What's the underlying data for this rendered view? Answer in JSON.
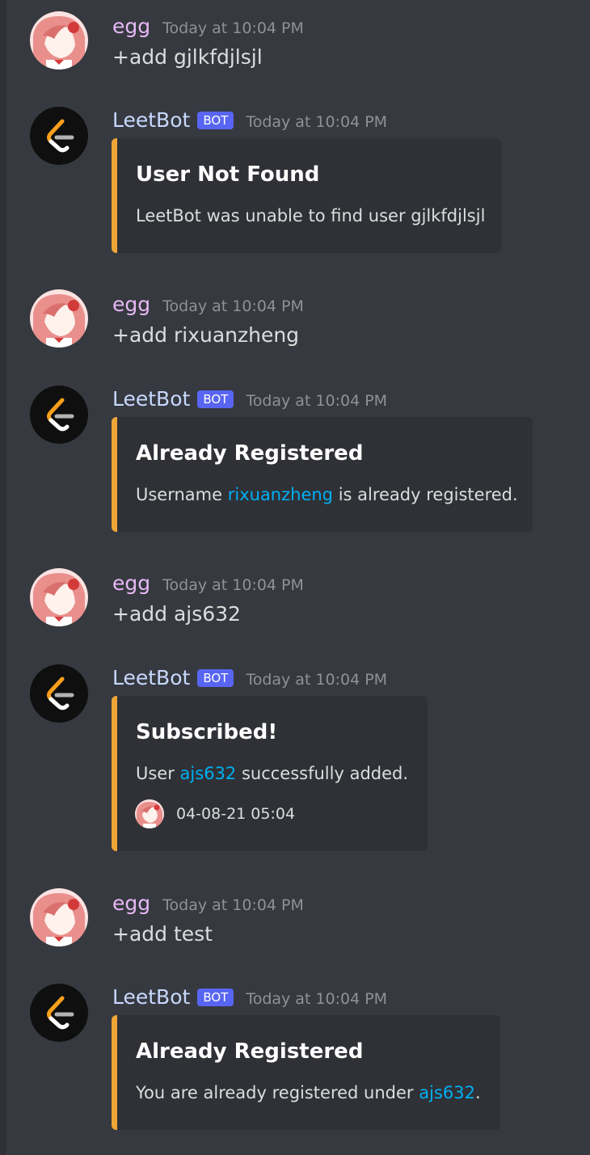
{
  "colors": {
    "background": "#36393f",
    "embed_background": "#2f3136",
    "embed_accent": "#f0a637",
    "link": "#00aff4",
    "bot_tag": "#5865f2"
  },
  "messages": [
    {
      "author": "egg",
      "timestamp": "Today at 10:04 PM",
      "avatar_icon": "anime-girl-avatar-icon",
      "text": "+add gjlkfdjlsjl"
    },
    {
      "author": "LeetBot",
      "bot_tag": "BOT",
      "timestamp": "Today at 10:04 PM",
      "avatar_icon": "leetcode-logo-icon",
      "embed": {
        "title": "User Not Found",
        "description": "LeetBot was unable to find user gjlkfdjlsjl"
      }
    },
    {
      "author": "egg",
      "timestamp": "Today at 10:04 PM",
      "avatar_icon": "anime-girl-avatar-icon",
      "text": "+add rixuanzheng"
    },
    {
      "author": "LeetBot",
      "bot_tag": "BOT",
      "timestamp": "Today at 10:04 PM",
      "avatar_icon": "leetcode-logo-icon",
      "embed": {
        "title": "Already Registered",
        "desc_before": "Username ",
        "desc_link": "rixuanzheng",
        "desc_after": " is already registered."
      }
    },
    {
      "author": "egg",
      "timestamp": "Today at 10:04 PM",
      "avatar_icon": "anime-girl-avatar-icon",
      "text": "+add ajs632"
    },
    {
      "author": "LeetBot",
      "bot_tag": "BOT",
      "timestamp": "Today at 10:04 PM",
      "avatar_icon": "leetcode-logo-icon",
      "embed": {
        "title": "Subscribed!",
        "desc_before": "User ",
        "desc_link": "ajs632",
        "desc_after": " successfully added.",
        "footer_text": "04-08-21 05:04"
      }
    },
    {
      "author": "egg",
      "timestamp": "Today at 10:04 PM",
      "avatar_icon": "anime-girl-avatar-icon",
      "text": "+add test"
    },
    {
      "author": "LeetBot",
      "bot_tag": "BOT",
      "timestamp": "Today at 10:04 PM",
      "avatar_icon": "leetcode-logo-icon",
      "embed": {
        "title": "Already Registered",
        "desc_before": "You are already registered under ",
        "desc_link": "ajs632",
        "desc_after": "."
      }
    }
  ]
}
